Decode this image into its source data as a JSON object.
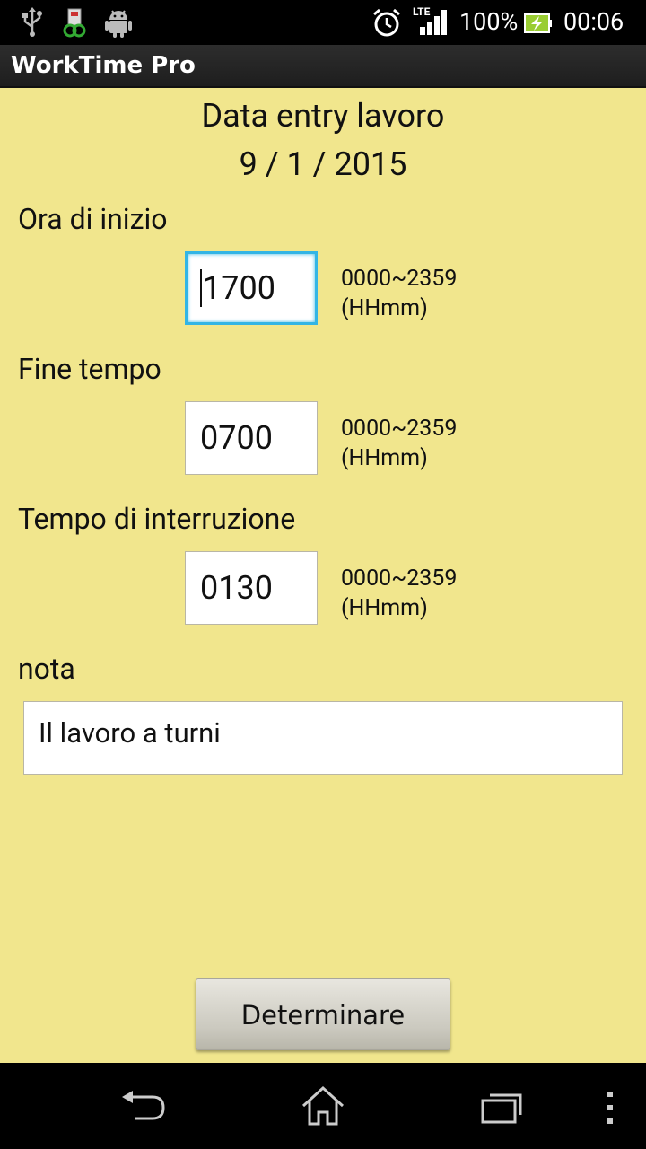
{
  "status_bar": {
    "network": "LTE",
    "battery": "100%",
    "time": "00:06"
  },
  "app": {
    "title": "WorkTime Pro"
  },
  "form": {
    "heading": "Data entry lavoro",
    "date": "9 / 1 / 2015",
    "start": {
      "label": "Ora di inizio",
      "value": "1700",
      "range": "0000~2359",
      "format": "(HHmm)"
    },
    "end": {
      "label": "Fine tempo",
      "value": "0700",
      "range": "0000~2359",
      "format": "(HHmm)"
    },
    "break": {
      "label": "Tempo di interruzione",
      "value": "0130",
      "range": "0000~2359",
      "format": "(HHmm)"
    },
    "note": {
      "label": "nota",
      "value": "Il lavoro a turni"
    },
    "submit_label": "Determinare"
  },
  "colors": {
    "background": "#f1e68d",
    "focus": "#33b5e5",
    "statusbar": "#000000"
  }
}
